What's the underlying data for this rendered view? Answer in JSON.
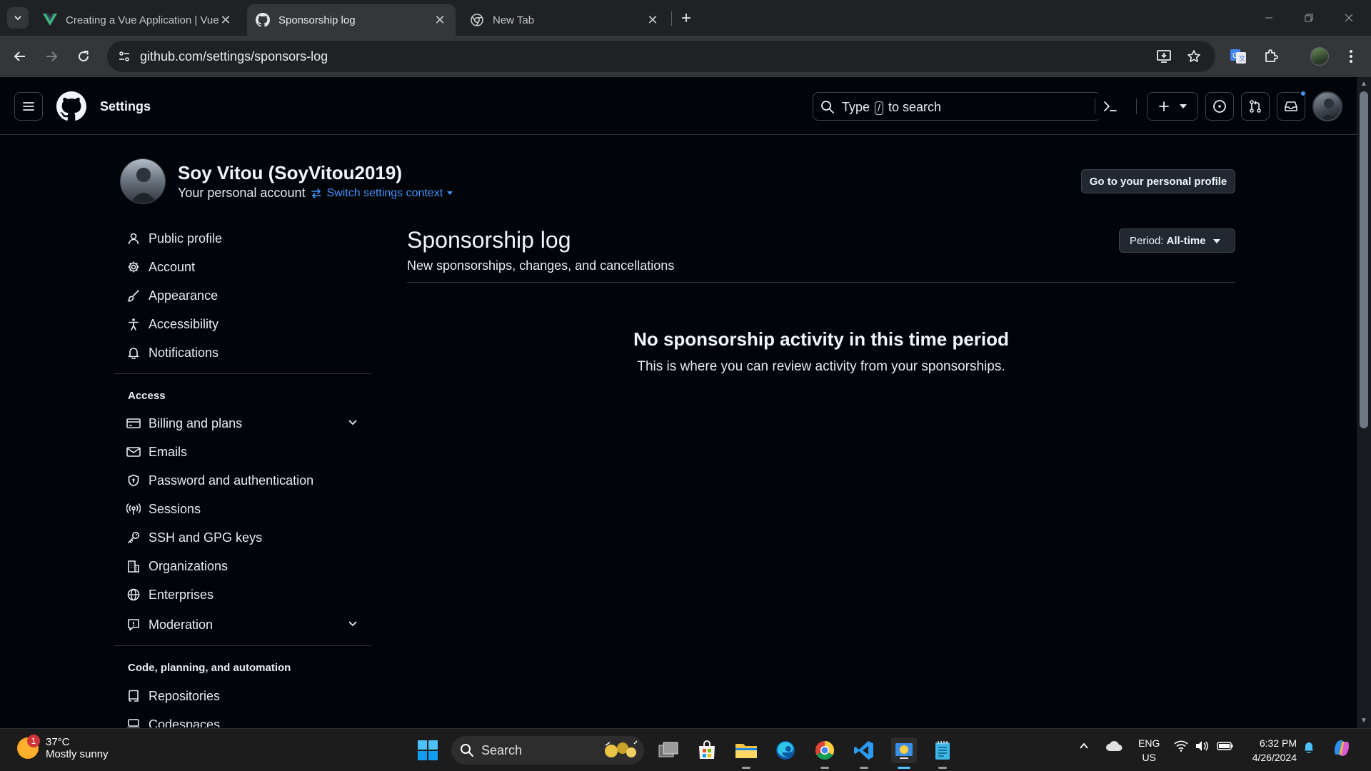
{
  "browser": {
    "tabs": [
      {
        "title": "Creating a Vue Application | Vue.js",
        "favicon": "vue-icon"
      },
      {
        "title": "Sponsorship log",
        "favicon": "github-icon"
      },
      {
        "title": "New Tab",
        "favicon": "chrome-icon"
      }
    ],
    "active_tab_index": 1,
    "url": "github.com/settings/sponsors-log"
  },
  "github_header": {
    "context": "Settings",
    "search_prefix": "Type",
    "search_key": "/",
    "search_suffix": "to search"
  },
  "profile": {
    "name": "Soy Vitou (SoyVitou2019)",
    "subtitle": "Your personal account",
    "switch_label": "Switch settings context",
    "go_profile_label": "Go to your personal profile"
  },
  "sidebar": {
    "top_items": [
      {
        "label": "Public profile",
        "icon": "person-icon"
      },
      {
        "label": "Account",
        "icon": "gear-icon"
      },
      {
        "label": "Appearance",
        "icon": "paintbrush-icon"
      },
      {
        "label": "Accessibility",
        "icon": "accessibility-icon"
      },
      {
        "label": "Notifications",
        "icon": "bell-icon"
      }
    ],
    "access_heading": "Access",
    "access_items": [
      {
        "label": "Billing and plans",
        "icon": "credit-card-icon",
        "expandable": true
      },
      {
        "label": "Emails",
        "icon": "mail-icon"
      },
      {
        "label": "Password and authentication",
        "icon": "shield-lock-icon"
      },
      {
        "label": "Sessions",
        "icon": "broadcast-icon"
      },
      {
        "label": "SSH and GPG keys",
        "icon": "key-icon"
      },
      {
        "label": "Organizations",
        "icon": "organization-icon"
      },
      {
        "label": "Enterprises",
        "icon": "globe-icon"
      },
      {
        "label": "Moderation",
        "icon": "report-icon",
        "expandable": true
      }
    ],
    "code_heading": "Code, planning, and automation",
    "code_items": [
      {
        "label": "Repositories",
        "icon": "repo-icon"
      },
      {
        "label": "Codespaces",
        "icon": "codespaces-icon"
      }
    ]
  },
  "main": {
    "title": "Sponsorship log",
    "description": "New sponsorships, changes, and cancellations",
    "period_prefix": "Period:",
    "period_value": "All-time",
    "empty_title": "No sponsorship activity in this time period",
    "empty_description": "This is where you can review activity from your sponsorships."
  },
  "taskbar": {
    "weather_temp": "37°C",
    "weather_desc": "Mostly sunny",
    "weather_badge": "1",
    "search_label": "Search",
    "lang_line1": "ENG",
    "lang_line2": "US",
    "time": "6:32 PM",
    "date": "4/26/2024"
  },
  "colors": {
    "accent_link": "#4493f8",
    "background": "#010409",
    "border": "#30363d"
  }
}
